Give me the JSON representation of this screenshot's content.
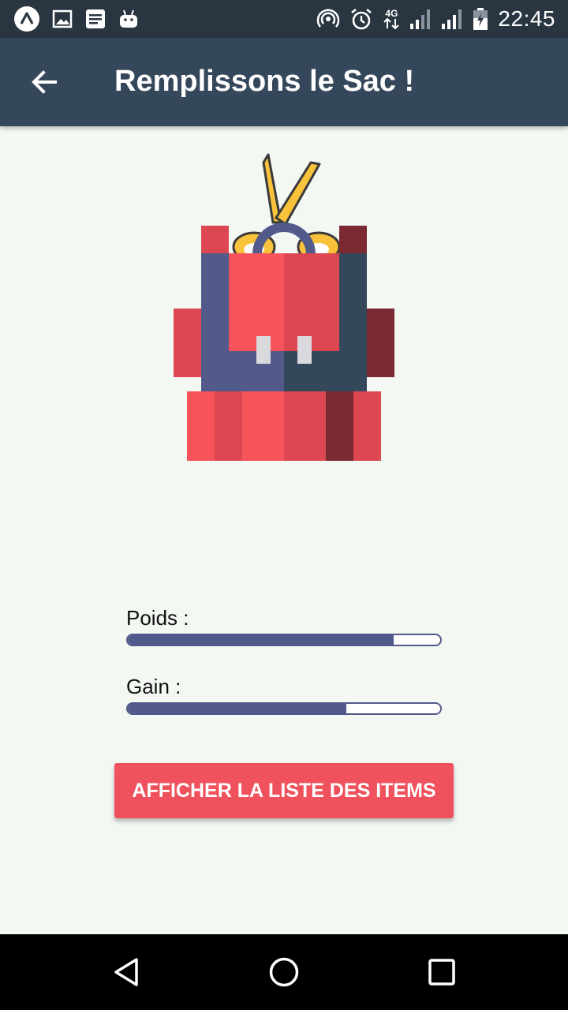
{
  "status_bar": {
    "time": "22:45",
    "network_label": "4G",
    "left_icons": [
      "expo-icon",
      "image-icon",
      "document-icon",
      "android-icon"
    ],
    "right_icons": [
      "hotspot-icon",
      "alarm-icon",
      "signal-icon",
      "signal-icon",
      "battery-icon"
    ]
  },
  "app_bar": {
    "title": "Remplissons le Sac !",
    "back_icon": "arrow-left-icon"
  },
  "illustration": {
    "icon": "backpack-icon"
  },
  "metrics": {
    "weight": {
      "label": "Poids :",
      "fraction": 0.85
    },
    "gain": {
      "label": "Gain :",
      "fraction": 0.7
    }
  },
  "actions": {
    "show_items_label": "AFFICHER LA LISTE DES ITEMS"
  },
  "nav_bar": {
    "icons": [
      "back-triangle-icon",
      "home-circle-icon",
      "recents-square-icon"
    ]
  },
  "colors": {
    "status_bar": "#293642",
    "app_bar": "#35475a",
    "background": "#f4f8f3",
    "accent": "#ef525c",
    "progress": "#515a8a"
  }
}
